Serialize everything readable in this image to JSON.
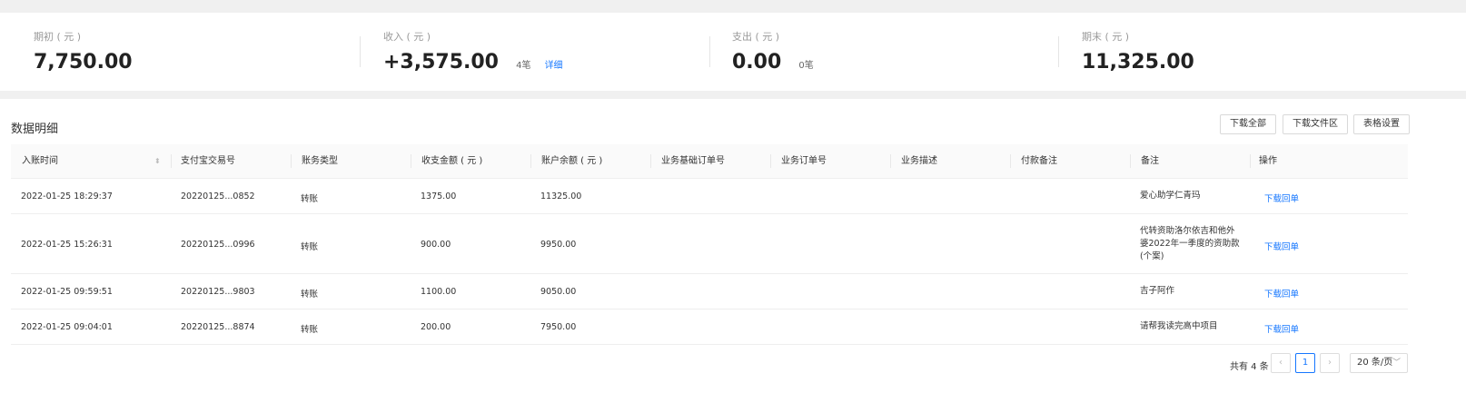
{
  "summary": {
    "opening": {
      "label": "期初 ( 元 )",
      "value": "7,750.00"
    },
    "income": {
      "label": "收入 ( 元 )",
      "value": "+3,575.00",
      "count": "4笔",
      "detail_link": "详细"
    },
    "expense": {
      "label": "支出 ( 元 )",
      "value": "0.00",
      "count": "0笔"
    },
    "closing": {
      "label": "期末 ( 元 )",
      "value": "11,325.00"
    }
  },
  "details": {
    "title": "数据明细",
    "buttons": {
      "download_all": "下载全部",
      "download_file_area": "下载文件区",
      "table_settings": "表格设置"
    },
    "columns": [
      "入账时间",
      "支付宝交易号",
      "账务类型",
      "收支金额 ( 元 )",
      "账户余额 ( 元 )",
      "业务基础订单号",
      "业务订单号",
      "业务描述",
      "付款备注",
      "备注",
      "操作"
    ],
    "rows": [
      {
        "time": "2022-01-25 18:29:37",
        "trade_no": "20220125...0852",
        "type": "转账",
        "amount": "1375.00",
        "balance": "11325.00",
        "note": "爱心助学仁青玛",
        "action": "下载回单"
      },
      {
        "time": "2022-01-25 15:26:31",
        "trade_no": "20220125...0996",
        "type": "转账",
        "amount": "900.00",
        "balance": "9950.00",
        "note": "代转资助洛尔依吉和他外婆2022年一季度的资助款 (个案)",
        "action": "下载回单"
      },
      {
        "time": "2022-01-25 09:59:51",
        "trade_no": "20220125...9803",
        "type": "转账",
        "amount": "1100.00",
        "balance": "9050.00",
        "note": "吉子阿作",
        "action": "下载回单"
      },
      {
        "time": "2022-01-25 09:04:01",
        "trade_no": "20220125...8874",
        "type": "转账",
        "amount": "200.00",
        "balance": "7950.00",
        "note": "请帮我读完高中项目",
        "action": "下载回单"
      }
    ]
  },
  "pagination": {
    "total": "共有 4 条",
    "prev": "‹",
    "current": "1",
    "next": "›",
    "page_size": "20 条/页"
  }
}
